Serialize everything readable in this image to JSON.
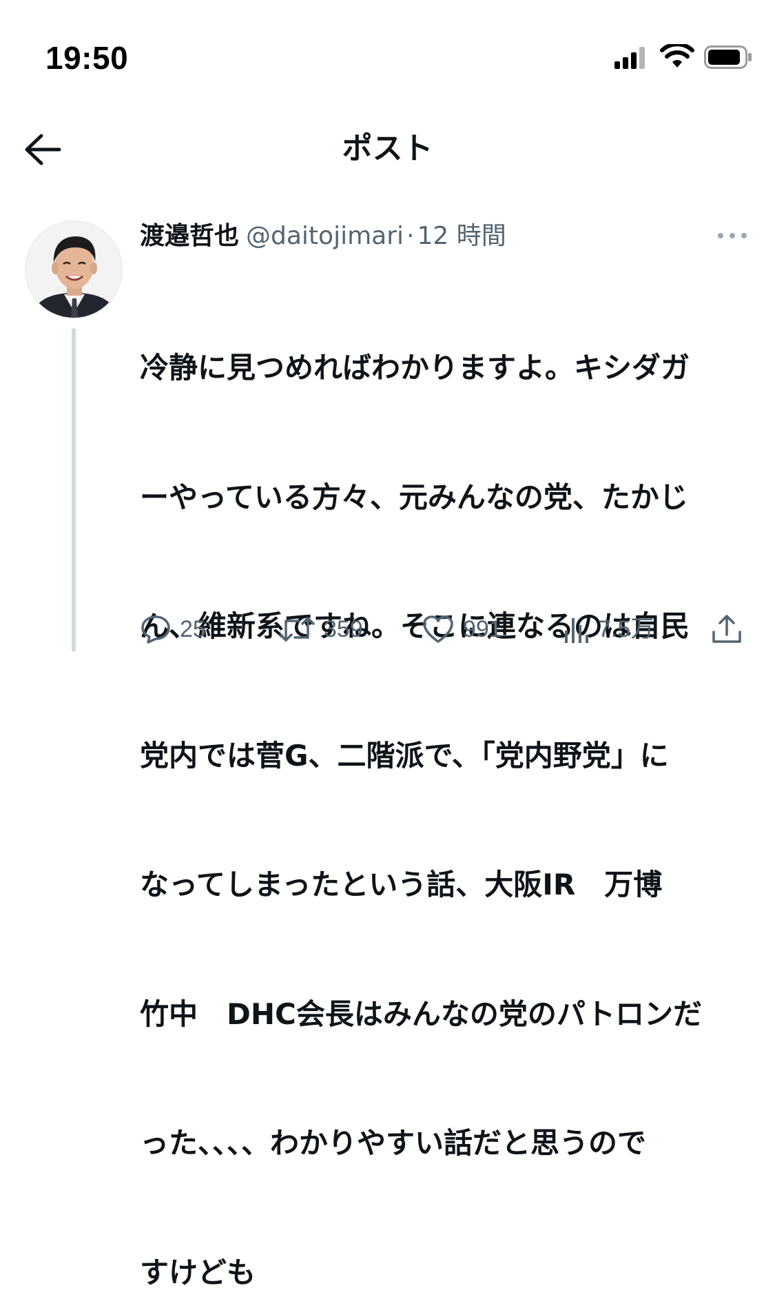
{
  "status_bar": {
    "time": "19:50"
  },
  "header": {
    "title": "ポスト",
    "back_icon": "arrow-left-icon"
  },
  "post": {
    "author": {
      "display_name": "渡邉哲也",
      "handle": "@daitojimari",
      "avatar_icon": "avatar-photo"
    },
    "separator": "·",
    "time": "12 時間",
    "more_icon": "more-horizontal-icon",
    "text_lines": [
      "冷静に見つめればわかりますよ。キシダガ",
      "ーやっている方々、元みんなの党、たかじ",
      "ん、維新系ですね。そこに連なるのは自民",
      "党内では菅G、二階派で、「党内野党」に",
      "なってしまったという話、大阪IR　万博",
      "竹中　DHC会長はみんなの党のパトロンだ",
      "った、、、、わかりやすい話だと思うので",
      "すけども"
    ],
    "metrics": {
      "replies": "25",
      "reposts": "359",
      "likes": "991",
      "views": "7.5万"
    }
  },
  "colors": {
    "text_primary": "#0f1419",
    "text_secondary": "#536471",
    "thread_line": "#cfd9de",
    "background": "#ffffff"
  }
}
